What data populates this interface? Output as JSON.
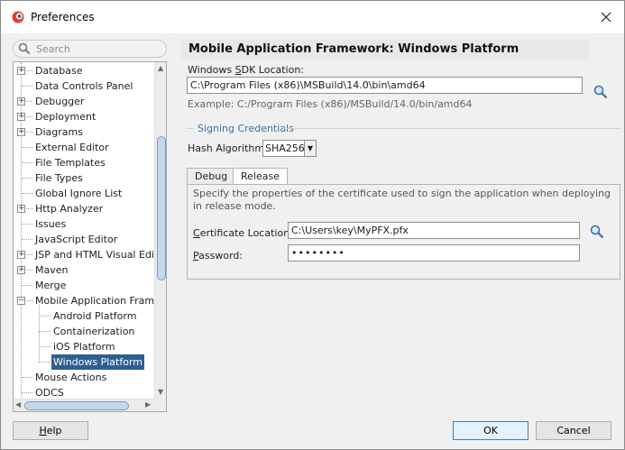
{
  "window": {
    "title": "Preferences"
  },
  "search": {
    "placeholder": "Search"
  },
  "tree": {
    "items": [
      {
        "label": "Database",
        "expandable": true
      },
      {
        "label": "Data Controls Panel",
        "expandable": false
      },
      {
        "label": "Debugger",
        "expandable": true
      },
      {
        "label": "Deployment",
        "expandable": true
      },
      {
        "label": "Diagrams",
        "expandable": true
      },
      {
        "label": "External Editor",
        "expandable": false
      },
      {
        "label": "File Templates",
        "expandable": false
      },
      {
        "label": "File Types",
        "expandable": false
      },
      {
        "label": "Global Ignore List",
        "expandable": false
      },
      {
        "label": "Http Analyzer",
        "expandable": true
      },
      {
        "label": "Issues",
        "expandable": false
      },
      {
        "label": "JavaScript Editor",
        "expandable": false
      },
      {
        "label": "JSP and HTML Visual Editor",
        "expandable": true
      },
      {
        "label": "Maven",
        "expandable": true
      },
      {
        "label": "Merge",
        "expandable": false
      },
      {
        "label": "Mobile Application Framewo",
        "expandable": true,
        "expanded": true
      },
      {
        "label": "Android Platform",
        "child": true
      },
      {
        "label": "Containerization",
        "child": true
      },
      {
        "label": "iOS Platform",
        "child": true
      },
      {
        "label": "Windows Platform",
        "child": true,
        "selected": true
      },
      {
        "label": "Mouse Actions",
        "expandable": false
      },
      {
        "label": "ODCS",
        "expandable": false
      }
    ]
  },
  "panel": {
    "title": "Mobile Application Framework: Windows Platform",
    "sdk_label_pre": "Windows ",
    "sdk_label_ul": "S",
    "sdk_label_post": "DK Location:",
    "sdk_value": "C:\\Program Files (x86)\\MSBuild\\14.0\\bin\\amd64",
    "sdk_example": "Example: C:/Program Files (x86)/MSBuild/14.0/bin/amd64",
    "signing_title": "Signing Credentials",
    "hash_label": "Hash Algorithm:",
    "hash_value": "SHA256",
    "tabs": [
      "Debug",
      "Release"
    ],
    "active_tab": "Release",
    "release_desc": "Specify the properties of the certificate used to sign the application when deploying in release mode.",
    "cert_label_ul": "C",
    "cert_label_post": "ertificate Location:",
    "cert_value": "C:\\Users\\key\\MyPFX.pfx",
    "password_label_ul": "P",
    "password_label_post": "assword:",
    "password_value": "••••••••"
  },
  "buttons": {
    "help_ul": "H",
    "help_post": "elp",
    "ok": "OK",
    "cancel": "Cancel"
  },
  "colors": {
    "selection": "#2f5f91",
    "section_title": "#3c6ea0",
    "app_icon_red": "#d9452b"
  }
}
